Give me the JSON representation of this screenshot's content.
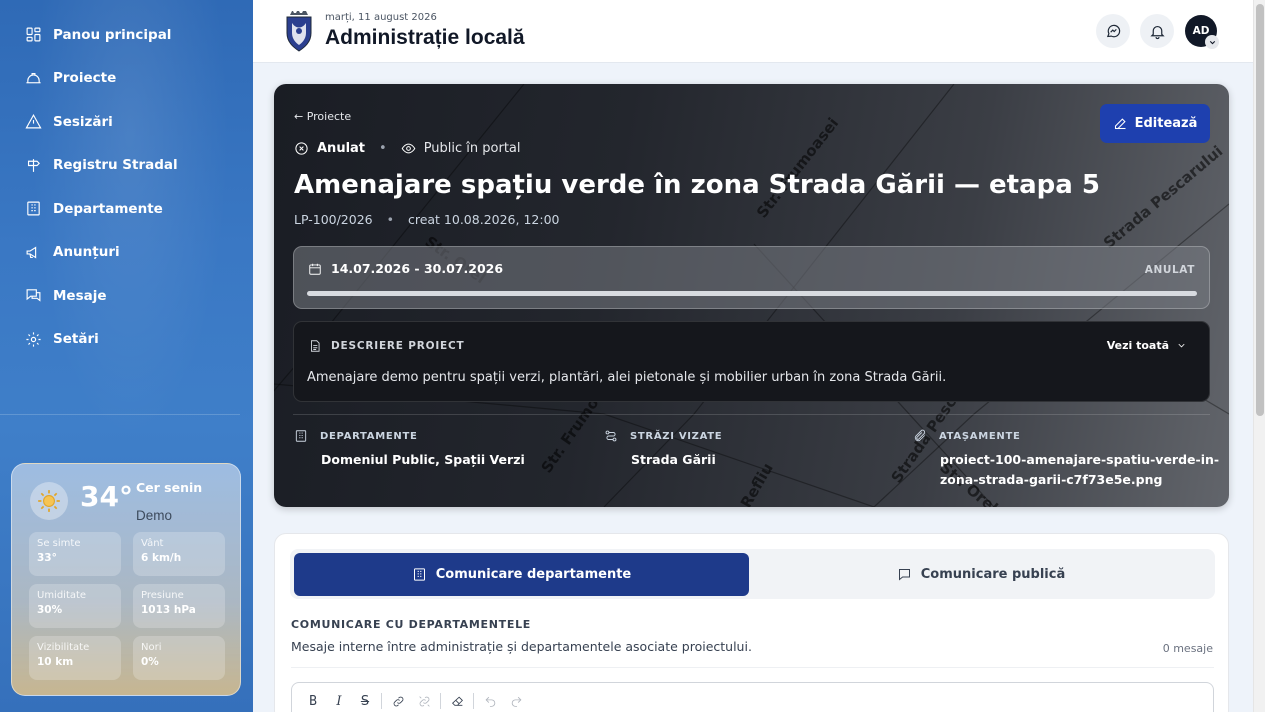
{
  "sidebar": {
    "items": [
      {
        "label": "Panou principal",
        "icon": "dashboard-icon"
      },
      {
        "label": "Proiecte",
        "icon": "hardhat-icon"
      },
      {
        "label": "Sesizări",
        "icon": "warning-icon"
      },
      {
        "label": "Registru Stradal",
        "icon": "signpost-icon"
      },
      {
        "label": "Departamente",
        "icon": "building-icon"
      },
      {
        "label": "Anunțuri",
        "icon": "megaphone-icon"
      },
      {
        "label": "Mesaje",
        "icon": "messages-icon"
      },
      {
        "label": "Setări",
        "icon": "gear-icon"
      }
    ]
  },
  "weather": {
    "temp": "34°",
    "condition": "Cer senin",
    "demo_label": "Demo",
    "feels_label": "Se simte",
    "feels_value": "33°",
    "wind_label": "Vânt",
    "wind_value": "6 km/h",
    "humidity_label": "Umiditate",
    "humidity_value": "30%",
    "pressure_label": "Presiune",
    "pressure_value": "1013 hPa",
    "visibility_label": "Vizibilitate",
    "visibility_value": "10 km",
    "clouds_label": "Nori",
    "clouds_value": "0%"
  },
  "header": {
    "date": "marți, 11 august 2026",
    "title": "Administrație locală",
    "avatar_initials": "AD"
  },
  "project": {
    "back_label": "← Proiecte",
    "status": "Anulat",
    "visibility": "Public în portal",
    "title": "Amenajare spațiu verde în zona Strada Gării — etapa 5",
    "code": "LP-100/2026",
    "created": "creat 10.08.2026, 12:00",
    "edit_label": "Editează",
    "period": "14.07.2026 - 30.07.2026",
    "period_status": "ANULAT",
    "progress": 1.0,
    "description_heading": "DESCRIERE PROIECT",
    "see_all_label": "Vezi toată",
    "description": "Amenajare demo pentru spații verzi, plantări, alei pietonale și mobilier urban în zona Strada Gării.",
    "departments_label": "DEPARTAMENTE",
    "departments_value": "Domeniul Public, Spații Verzi",
    "streets_label": "STRĂZI VIZATE",
    "streets_value": "Strada Gării",
    "attachments_label": "ATAȘAMENTE",
    "attachment_line1": "proiect-100-amenajare-spatiu-verde-in-",
    "attachment_line2": "zona-strada-garii-c7f73e5e.png",
    "map_labels": [
      "Str. Frumoasei",
      "Strada Pescarului",
      "Str. Orel",
      "Str. Frumoasei",
      "Strada Pescarului",
      "Str. Orel",
      "Refliu"
    ]
  },
  "communication": {
    "tab_departments": "Comunicare departamente",
    "tab_public": "Comunicare publică",
    "heading": "COMUNICARE CU DEPARTAMENTELE",
    "subtitle": "Mesaje interne între administrație și departamentele asociate proiectului.",
    "count": "0 mesaje",
    "toolbar": {
      "bold": "B",
      "italic": "I",
      "strike": "S"
    }
  },
  "colors": {
    "sidebar": "#3a78c4",
    "primary": "#1e40af",
    "active_tab": "#1e3a8a",
    "hero_dark": "#1a1d24"
  }
}
